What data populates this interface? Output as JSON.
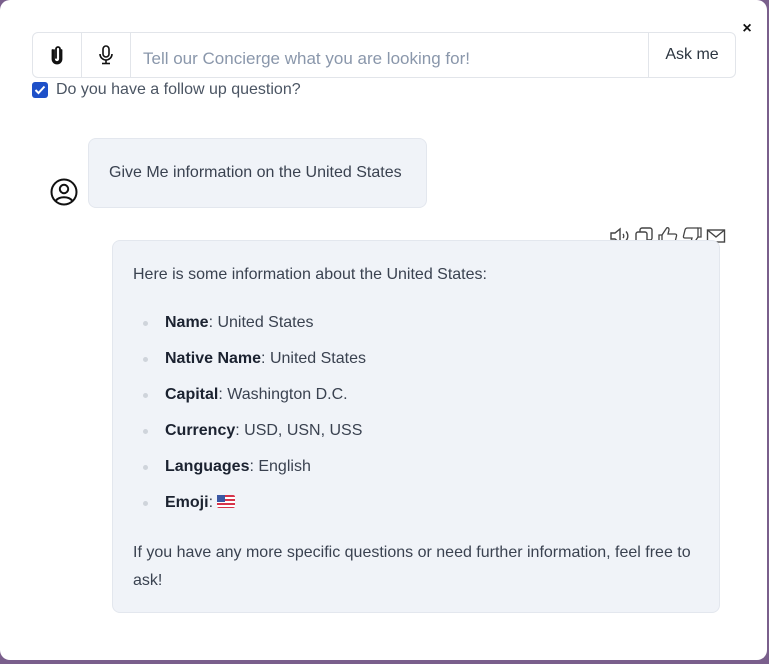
{
  "modal": {
    "close_label": "×"
  },
  "search": {
    "attach_icon": "paperclip-icon",
    "mic_icon": "microphone-icon",
    "placeholder": "Tell our Concierge what you are looking for!",
    "value": "",
    "submit_label": "Ask me"
  },
  "followup": {
    "checked": true,
    "label": "Do you have a follow up question?"
  },
  "conversation": {
    "user_message": "Give Me information on the United States",
    "response_actions": [
      {
        "icon": "speaker-icon",
        "label": "Read aloud"
      },
      {
        "icon": "copy-icon",
        "label": "Copy"
      },
      {
        "icon": "thumbs-up-icon",
        "label": "Like"
      },
      {
        "icon": "thumbs-down-icon",
        "label": "Dislike"
      },
      {
        "icon": "envelope-icon",
        "label": "Email"
      }
    ],
    "response": {
      "intro": "Here is some information about the United States:",
      "facts": [
        {
          "key": "Name",
          "value": ": United States"
        },
        {
          "key": "Native Name",
          "value": ": United States"
        },
        {
          "key": "Capital",
          "value": ": Washington D.C."
        },
        {
          "key": "Currency",
          "value": ": USD, USN, USS"
        },
        {
          "key": "Languages",
          "value": ": English"
        },
        {
          "key": "Emoji",
          "value": ": "
        }
      ],
      "outro": "If you have any more specific questions or need further information, feel free to ask!"
    }
  },
  "colors": {
    "backdrop": "#7a5f8c",
    "checkbox": "#1e50c8",
    "bubble_bg": "#f0f3f8",
    "placeholder": "#8a97ab"
  }
}
